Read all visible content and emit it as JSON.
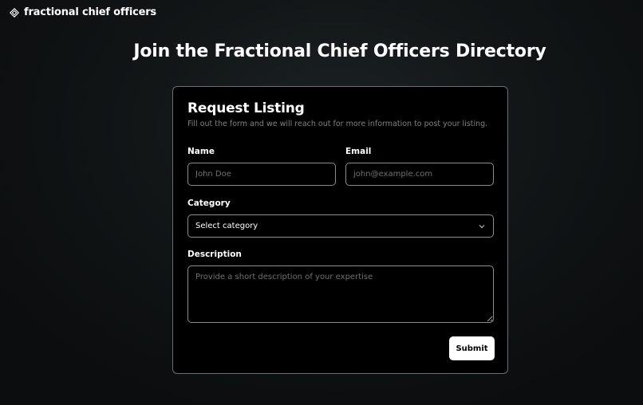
{
  "brand": {
    "name": "fractional chief officers"
  },
  "page": {
    "title": "Join the Fractional Chief Officers Directory"
  },
  "form": {
    "title": "Request Listing",
    "subtitle": "Fill out the form and we will reach out for more information to post your listing.",
    "name": {
      "label": "Name",
      "placeholder": "John Doe"
    },
    "email": {
      "label": "Email",
      "placeholder": "john@example.com"
    },
    "category": {
      "label": "Category",
      "value": "Select category"
    },
    "description": {
      "label": "Description",
      "placeholder": "Provide a short description of your expertise"
    },
    "submit_label": "Submit"
  },
  "colors": {
    "background": "#0b0d0e",
    "card": "#000000",
    "border": "#6b6f72",
    "button": "#ffffff"
  },
  "icons": {
    "logo": "diamond-logo-icon",
    "select": "chevron-down-icon"
  }
}
